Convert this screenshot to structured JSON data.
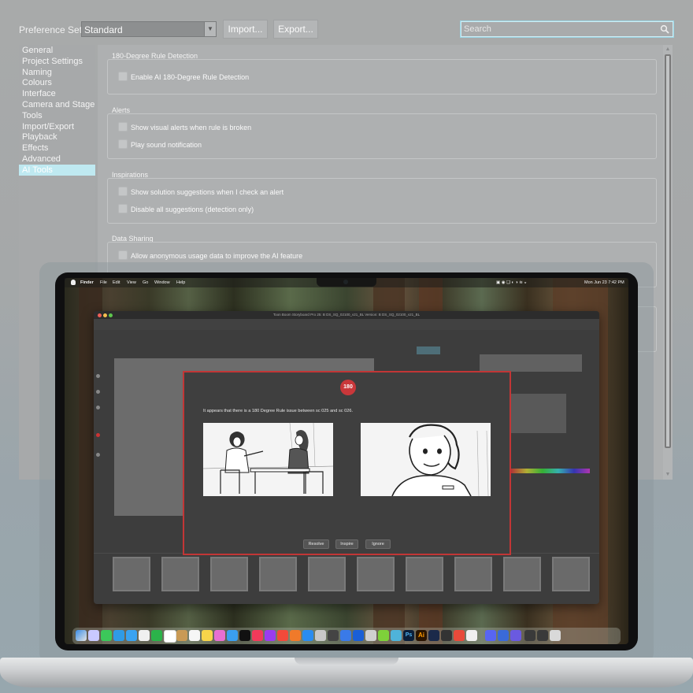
{
  "preferences": {
    "preference_set_label": "Preference Set:",
    "preference_set_value": "Standard",
    "import_label": "Import...",
    "export_label": "Export...",
    "search_placeholder": "Search",
    "sidebar": [
      {
        "label": "General"
      },
      {
        "label": "Project Settings"
      },
      {
        "label": "Naming"
      },
      {
        "label": "Colours"
      },
      {
        "label": "Interface"
      },
      {
        "label": "Camera and Stage"
      },
      {
        "label": "Tools"
      },
      {
        "label": "Import/Export"
      },
      {
        "label": "Playback"
      },
      {
        "label": "Effects"
      },
      {
        "label": "Advanced"
      },
      {
        "label": "AI Tools",
        "active": true
      }
    ],
    "sections": {
      "rule_detection": {
        "title": "180-Degree Rule Detection",
        "options": [
          "Enable AI 180-Degree Rule Detection"
        ]
      },
      "alerts": {
        "title": "Alerts",
        "options": [
          "Show visual alerts when rule is broken",
          "Play sound notification"
        ]
      },
      "inspirations": {
        "title": "Inspirations",
        "options": [
          "Show solution suggestions when I check an alert",
          "Disable all suggestions (detection only)"
        ]
      },
      "data_sharing": {
        "title": "Data Sharing",
        "options": [
          "Allow anonymous usage data to improve the AI feature"
        ]
      }
    }
  },
  "mac": {
    "menubar": {
      "app": "Finder",
      "items": [
        "File",
        "Edit",
        "View",
        "Go",
        "Window",
        "Help"
      ],
      "clock": "Mon Jun 23  7:42 PM"
    },
    "app_window_title": "Toon Boom Storyboard Pro 25: B  DS_SQ_02100_v21_BL Version: B  DS_SQ_02100_v21_BL",
    "dialog": {
      "badge": "180",
      "message": "It appears that there is a 180 Degree Rule issue between sc 025 and sc 026.",
      "buttons": {
        "resolve": "Resolve",
        "inspire": "Inspire",
        "ignore": "Ignore"
      }
    },
    "dock_ai_label": "Ai",
    "dock_ps_label": "Ps"
  },
  "colors": {
    "accent_active": "#bfe9f1",
    "dialog_border": "#c23636",
    "badge": "#c9373a"
  }
}
